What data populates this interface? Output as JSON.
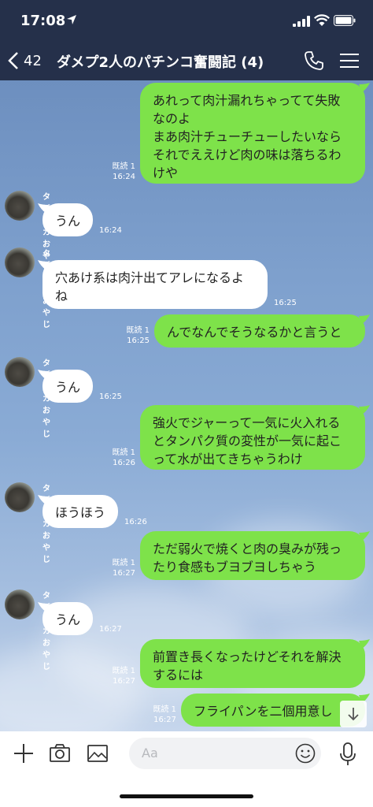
{
  "status": {
    "time": "17:08"
  },
  "header": {
    "back_count": "42",
    "title": "ダメプ2人のパチンコ奮闘記 (4)"
  },
  "messages": [
    {
      "dir": "out",
      "text": "あれって肉汁漏れちゃってて失敗\nなのよ\nまあ肉汁チューチューしたいなら\nそれでええけど肉の味は落ちるわ\nけや",
      "read": "既読 1",
      "time": "16:24"
    },
    {
      "dir": "in",
      "sender": "タピオカおやじ",
      "text": "うん",
      "time": "16:24"
    },
    {
      "dir": "in",
      "sender": "タピオカおやじ",
      "text": "穴あけ系は肉汁出てアレになるよ\nね",
      "time": "16:25"
    },
    {
      "dir": "out",
      "text": "んでなんでそうなるかと言うと",
      "read": "既読 1",
      "time": "16:25"
    },
    {
      "dir": "in",
      "sender": "タピオカおやじ",
      "text": "うん",
      "time": "16:25"
    },
    {
      "dir": "out",
      "text": "強火でジャーって一気に火入れる\nとタンパク質の変性が一気に起こ\nって水が出てきちゃうわけ",
      "read": "既読 1",
      "time": "16:26"
    },
    {
      "dir": "in",
      "sender": "タピオカおやじ",
      "text": "ほうほう",
      "time": "16:26"
    },
    {
      "dir": "out",
      "text": "ただ弱火で焼くと肉の臭みが残っ\nたり食感もブヨブヨしちゃう",
      "read": "既読 1",
      "time": "16:27"
    },
    {
      "dir": "in",
      "sender": "タピオカおやじ",
      "text": "うん",
      "time": "16:27"
    },
    {
      "dir": "out",
      "text": "前置き長くなったけどそれを解決\nするには",
      "read": "既読 1",
      "time": "16:27"
    },
    {
      "dir": "out",
      "text": "フライパンを二個用意し",
      "read": "既読 1",
      "time": "16:27"
    }
  ],
  "input": {
    "placeholder": "Aa"
  },
  "colors": {
    "header_bg": "#25304a",
    "outgoing_bubble": "#7ee24a",
    "incoming_bubble": "#ffffff"
  }
}
